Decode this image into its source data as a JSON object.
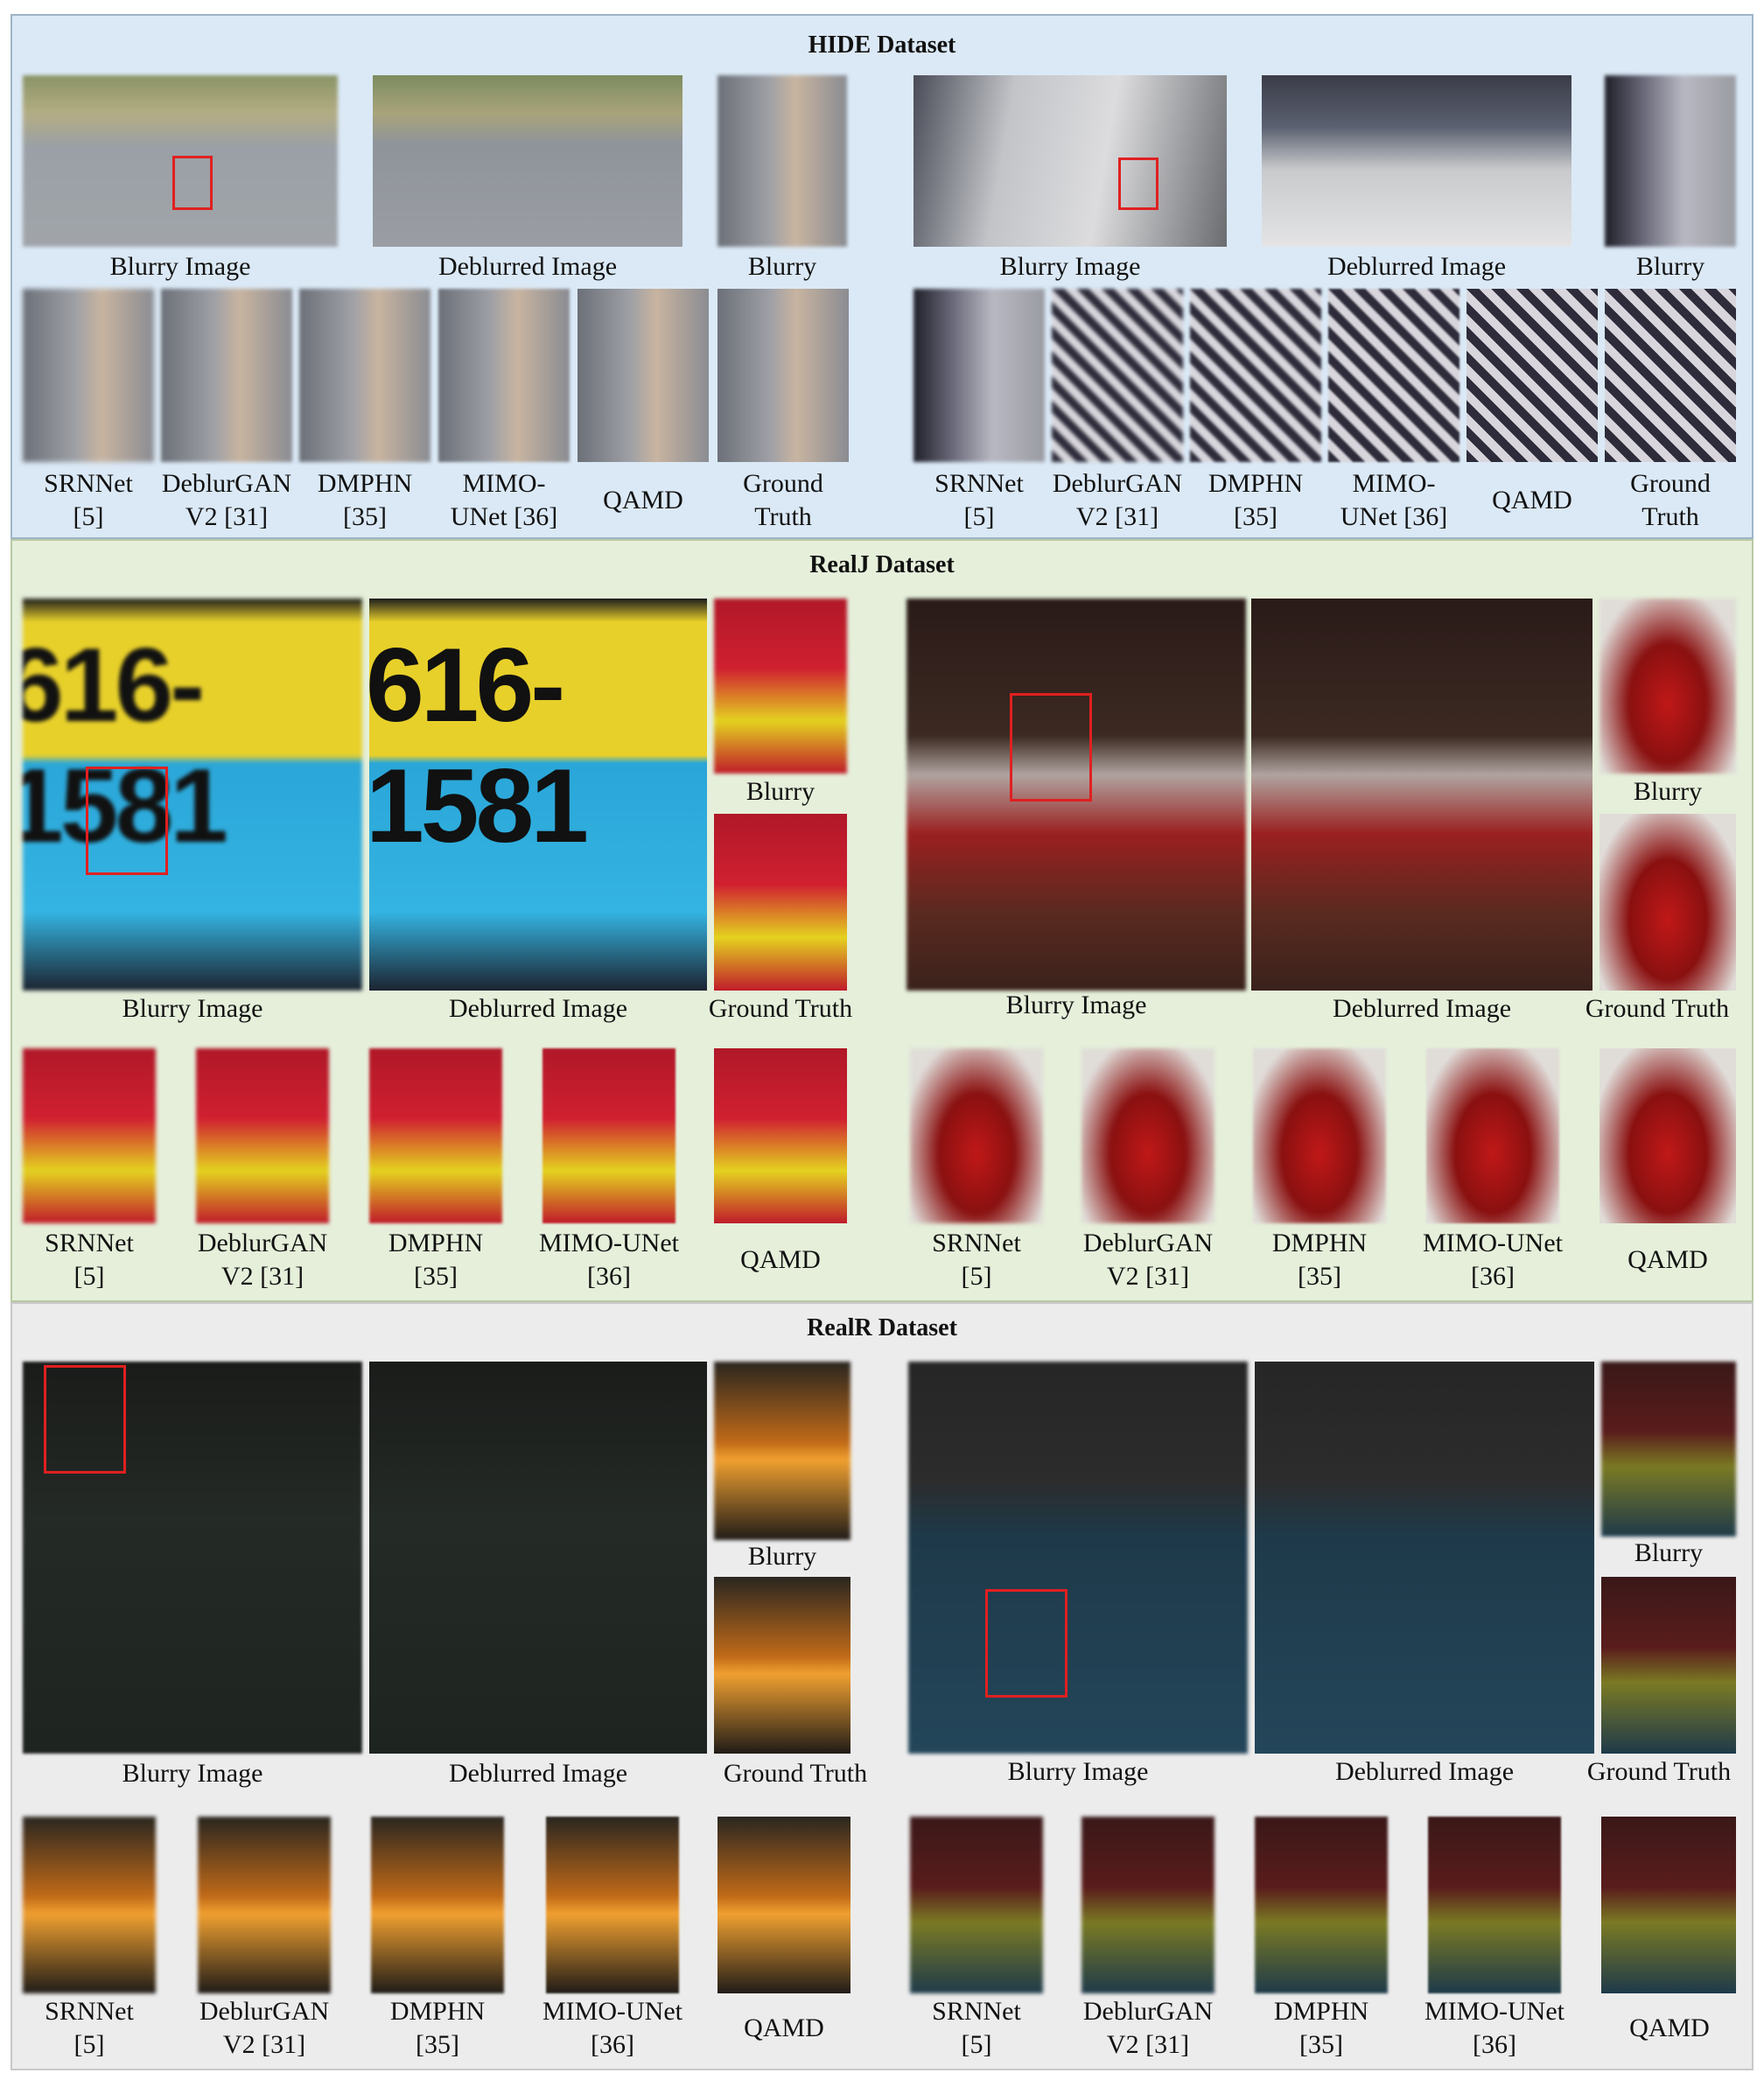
{
  "panels": {
    "hide": {
      "title": "HIDE Dataset",
      "blurry_image": "Blurry Image",
      "deblurred_image": "Deblurred Image",
      "blurry": "Blurry",
      "methods": [
        {
          "l1": "SRNNet",
          "l2": "[5]"
        },
        {
          "l1": "DeblurGAN",
          "l2": "V2 [31]"
        },
        {
          "l1": "DMPHN",
          "l2": "[35]"
        },
        {
          "l1": "MIMO-",
          "l2": "UNet [36]"
        },
        {
          "l1": "QAMD",
          "l2": ""
        },
        {
          "l1": "Ground",
          "l2": "Truth"
        }
      ]
    },
    "realj": {
      "title": "RealJ Dataset",
      "blurry_image": "Blurry Image",
      "deblurred_image": "Deblurred Image",
      "blurry": "Blurry",
      "ground_truth": "Ground Truth",
      "sign_text": "616-1581",
      "methods": [
        {
          "l1": "SRNNet",
          "l2": "[5]"
        },
        {
          "l1": "DeblurGAN",
          "l2": "V2 [31]"
        },
        {
          "l1": "DMPHN",
          "l2": "[35]"
        },
        {
          "l1": "MIMO-UNet",
          "l2": "[36]"
        },
        {
          "l1": "QAMD",
          "l2": ""
        }
      ]
    },
    "realr": {
      "title": "RealR Dataset",
      "blurry_image": "Blurry Image",
      "deblurred_image": "Deblurred Image",
      "blurry": "Blurry",
      "ground_truth": "Ground Truth",
      "methods": [
        {
          "l1": "SRNNet",
          "l2": "[5]"
        },
        {
          "l1": "DeblurGAN",
          "l2": "V2 [31]"
        },
        {
          "l1": "DMPHN",
          "l2": "[35]"
        },
        {
          "l1": "MIMO-UNet",
          "l2": "[36]"
        },
        {
          "l1": "QAMD",
          "l2": ""
        }
      ]
    }
  }
}
